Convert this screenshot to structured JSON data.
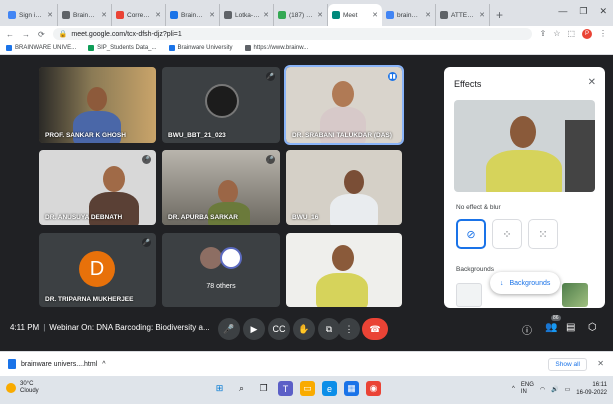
{
  "browser": {
    "tabs": [
      {
        "label": "Sign in to Su",
        "color": "#4285f4"
      },
      {
        "label": "Brainware",
        "color": "#5f6368"
      },
      {
        "label": "Correction",
        "color": "#ea4335"
      },
      {
        "label": "Brainware",
        "color": "#1a73e8"
      },
      {
        "label": "Lotka-Vol",
        "color": "#5f6368"
      },
      {
        "label": "(187) Wh",
        "color": "#34a853"
      },
      {
        "label": "Meet",
        "color": "#00897b",
        "active": true
      },
      {
        "label": "brainware",
        "color": "#4285f4"
      },
      {
        "label": "ATTENTION",
        "color": "#5f6368"
      }
    ],
    "new_tab": "+",
    "url": "meet.google.com/tcx-dfsh-djz?pli=1",
    "profile_initial": "P",
    "bookmarks": [
      {
        "label": "BRAINWARE UNIVE...",
        "color": "#1a73e8"
      },
      {
        "label": "SIP_Students Data_...",
        "color": "#0f9d58"
      },
      {
        "label": "Brainware University",
        "color": "#1a73e8"
      },
      {
        "label": "https://www.brainw...",
        "color": "#5f6368"
      }
    ]
  },
  "participants": [
    {
      "name": "PROF. SANKAR K GHOSH"
    },
    {
      "name": "BWU_BBT_21_023"
    },
    {
      "name": "DR. SRABANI TALUKDAR (DAS)"
    },
    {
      "name": "DR. ANUSUYA DEBNATH"
    },
    {
      "name": "DR. APURBA SARKAR"
    },
    {
      "name": "BWU_16"
    },
    {
      "name": "DR. TRIPARNA MUKHERJEE",
      "initial": "D"
    },
    {
      "name": "78 others"
    },
    {
      "name": ""
    }
  ],
  "effects_panel": {
    "title": "Effects",
    "close": "✕",
    "subtitle": "No effect & blur",
    "backgrounds_label": "Backgrounds",
    "backgrounds_button": "Backgrounds"
  },
  "meeting": {
    "time": "4:11 PM",
    "title": "Webinar On: DNA Barcoding: Biodiversity a...",
    "participant_count": "86"
  },
  "downloads": {
    "file": "brainware univers....html",
    "show_all": "Show all"
  },
  "taskbar": {
    "temperature": "30°C",
    "weather": "Cloudy",
    "lang_top": "ENG",
    "lang_bottom": "IN",
    "time": "16:11",
    "date": "16-09-2022"
  },
  "colors": {
    "meet_bg": "#202124",
    "tile_bg": "#3c4043",
    "accent": "#1a73e8",
    "end_call": "#ea4335",
    "avatar_orange": "#e8710a"
  }
}
